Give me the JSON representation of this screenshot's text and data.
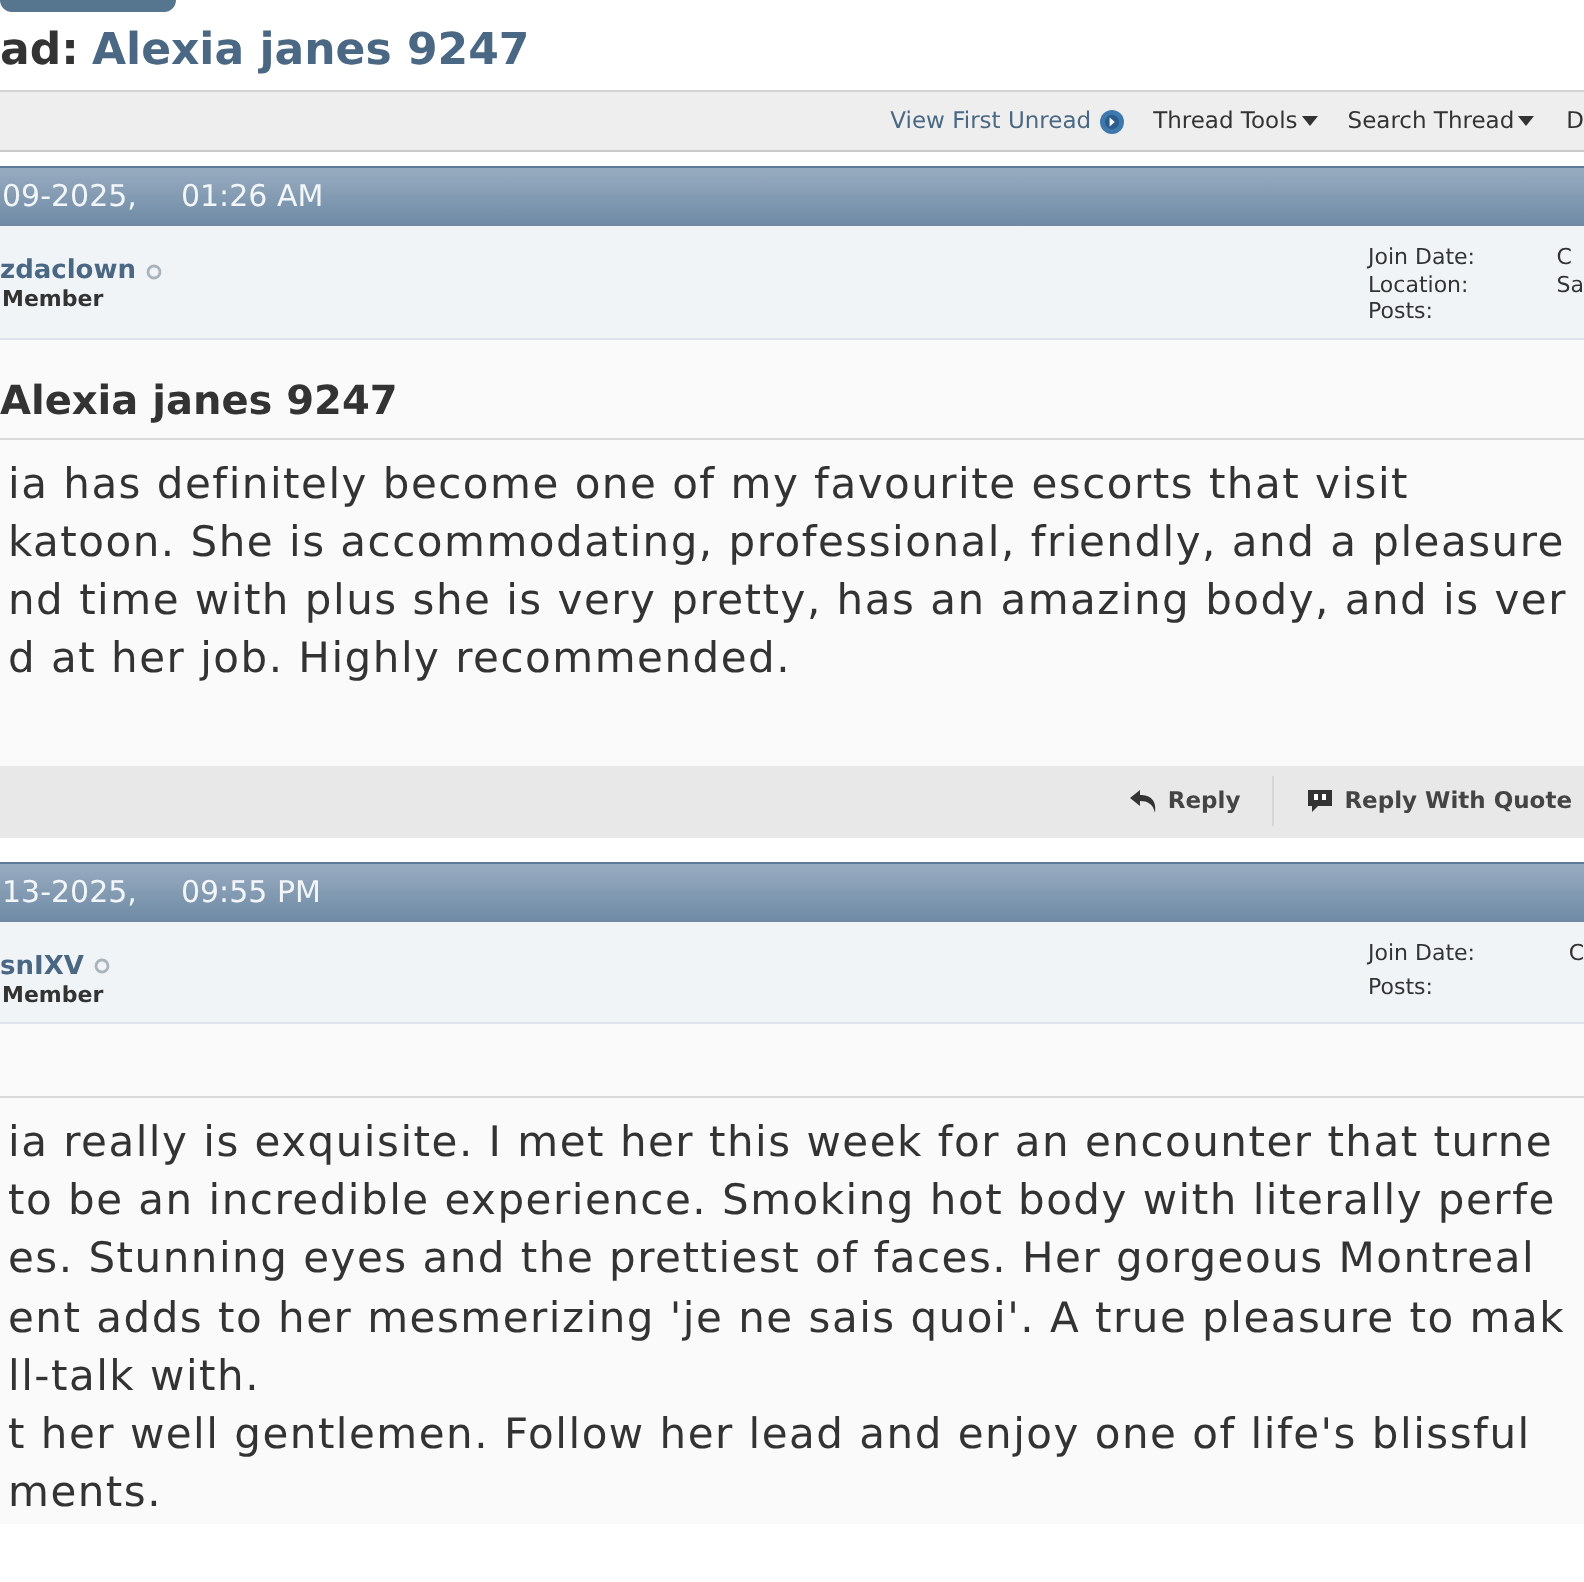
{
  "thread": {
    "prefix": "ad:",
    "title": "Alexia janes 9247"
  },
  "toolbar": [
    {
      "label": "View First Unread",
      "kind": "link"
    },
    {
      "label": "Thread Tools",
      "kind": "menu"
    },
    {
      "label": "Search Thread",
      "kind": "menu"
    },
    {
      "label": "D",
      "kind": "label"
    }
  ],
  "posts": [
    {
      "date": "09-2025,",
      "time": "01:26 AM",
      "author": {
        "name": "zdaclown",
        "online": false,
        "rank": "Member"
      },
      "stats": [
        {
          "label": "Join Date:",
          "value": "C"
        },
        {
          "label": "Location:",
          "value": "Sa"
        },
        {
          "label": "Posts:"
        }
      ],
      "title": "Alexia janes 9247",
      "lines": [
        "ia has definitely become one of my favourite escorts that visit",
        "katoon. She is accommodating, professional, friendly, and a pleasure",
        "nd time with plus she is very pretty, has an amazing body, and is ver",
        "d at her job. Highly recommended."
      ],
      "actions": [
        {
          "label": "Reply",
          "kind": "reply"
        },
        {
          "label": "Reply With Quote",
          "kind": "quote"
        }
      ]
    },
    {
      "date": "13-2025,",
      "time": "09:55 PM",
      "author": {
        "name": "snIXV",
        "online": false,
        "rank": "Member"
      },
      "stats": [
        {
          "label": "Join Date:",
          "value": "C"
        },
        {
          "label": "Posts:"
        }
      ],
      "lines": [
        "ia really is exquisite. I met her this week for an encounter that turne",
        "to be an incredible experience. Smoking hot body with literally perfe",
        "es. Stunning eyes and the prettiest of faces. Her gorgeous Montreal",
        "ent adds to her mesmerizing 'je ne sais quoi'. A true pleasure to mak",
        "ll-talk with.",
        "t her well gentlemen. Follow her lead and enjoy one of life's blissful",
        "ments."
      ]
    }
  ]
}
